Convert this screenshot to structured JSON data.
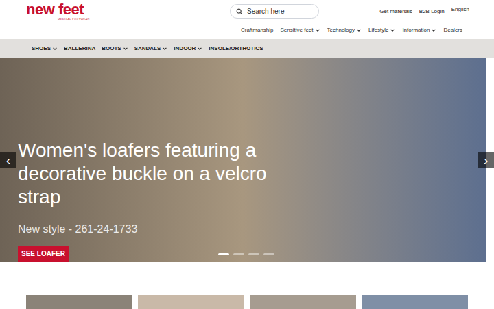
{
  "logo": {
    "name": "new feet",
    "tagline": "MEDICAL FOOTWEAR"
  },
  "search": {
    "placeholder": "Search here"
  },
  "top_links": [
    "Get materials",
    "B2B Login",
    "English"
  ],
  "secondary_nav": [
    {
      "label": "Craftmanship",
      "has_dropdown": false
    },
    {
      "label": "Sensitive feet",
      "has_dropdown": true
    },
    {
      "label": "Technology",
      "has_dropdown": true
    },
    {
      "label": "Lifestyle",
      "has_dropdown": true
    },
    {
      "label": "Information",
      "has_dropdown": true
    },
    {
      "label": "Dealers",
      "has_dropdown": false
    }
  ],
  "main_nav": [
    {
      "label": "SHOES",
      "has_dropdown": true
    },
    {
      "label": "BALLERINA",
      "has_dropdown": false
    },
    {
      "label": "BOOTS",
      "has_dropdown": true
    },
    {
      "label": "SANDALS",
      "has_dropdown": true
    },
    {
      "label": "INDOOR",
      "has_dropdown": true
    },
    {
      "label": "INSOLE/ORTHOTICS",
      "has_dropdown": false
    }
  ],
  "hero": {
    "title": "Women's loafers featuring a decorative buckle on a velcro strap",
    "subtitle": "New style - 261-24-1733",
    "button": "SEE LOAFER",
    "prev": "‹",
    "next": "›",
    "dots": [
      {
        "selected": true
      },
      {
        "selected": false
      },
      {
        "selected": false
      },
      {
        "selected": false
      }
    ]
  }
}
